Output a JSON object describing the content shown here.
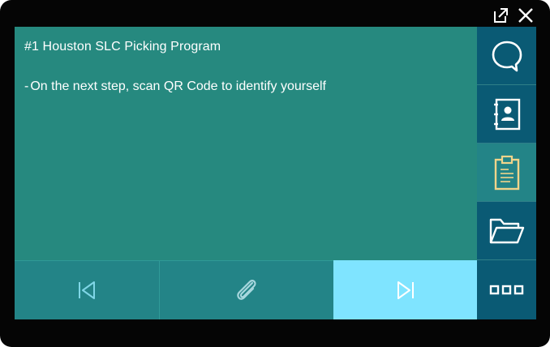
{
  "window": {
    "popout_icon": "external-link-icon",
    "close_icon": "close-icon"
  },
  "content": {
    "title": "#1  Houston SLC Picking Program",
    "instruction_bullet": "-",
    "instruction": "On the next step, scan QR Code to identify yourself"
  },
  "navbar": {
    "prev_icon": "skip-previous-icon",
    "attach_icon": "paperclip-icon",
    "next_icon": "skip-next-icon"
  },
  "sidebar": {
    "items": [
      {
        "icon": "chat-bubble-icon"
      },
      {
        "icon": "contact-book-icon"
      },
      {
        "icon": "clipboard-icon"
      },
      {
        "icon": "folder-open-icon"
      },
      {
        "icon": "more-icon"
      }
    ]
  },
  "colors": {
    "frame": "#050505",
    "content_bg": "#26897f",
    "sidebar_bg": "#0a5a74",
    "next_button_bg": "#7fe4ff",
    "clipboard_accent": "#f0d48a"
  }
}
